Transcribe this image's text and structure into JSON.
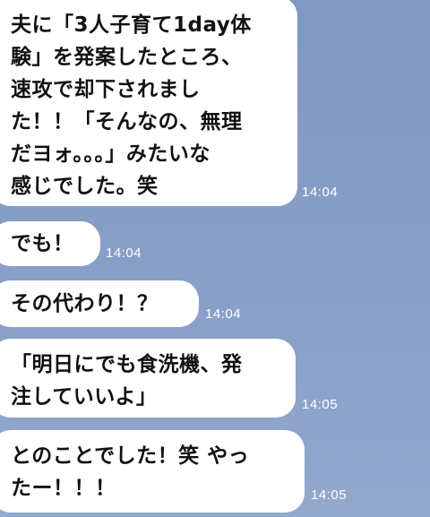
{
  "messages": [
    {
      "text": "夫に「3人子育て1day体\n験」を発案したところ、\n速攻で却下されまし\nた！！「そんなの、無理\nだヨォ。。。」みたいな\n感じでした。笑",
      "time": "14:04"
    },
    {
      "text": "でも！",
      "time": "14:04"
    },
    {
      "text": "その代わり！？",
      "time": "14:04"
    },
    {
      "text": "「明日にでも食洗機、発\n注していいよ」",
      "time": "14:05"
    },
    {
      "text": "とのことでした！笑 やっ\nたー！！！",
      "time": "14:05"
    }
  ],
  "colors": {
    "background": "#869dc6",
    "bubble": "#ffffff",
    "text": "#111111",
    "timestamp": "#ffffff"
  }
}
